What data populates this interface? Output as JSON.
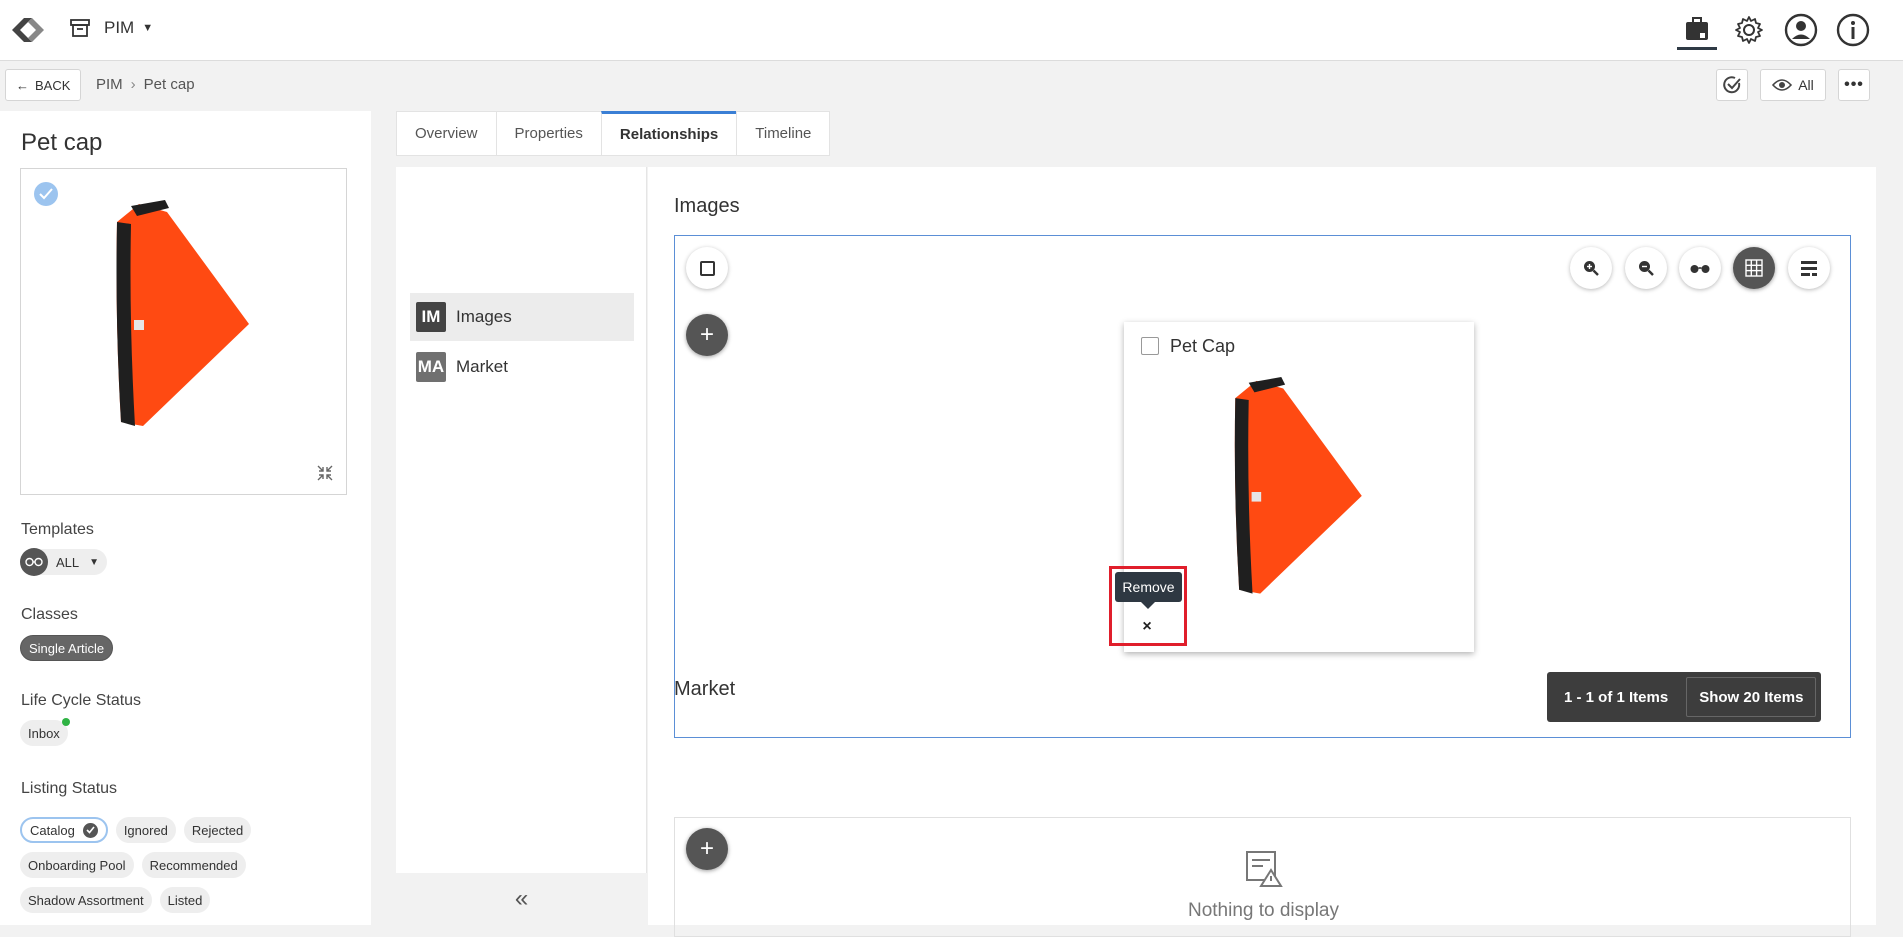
{
  "topbar": {
    "module_label": "PIM"
  },
  "subbar": {
    "back_label": "BACK",
    "breadcrumb": [
      "PIM",
      "Pet cap"
    ],
    "view_label": "All"
  },
  "left": {
    "title": "Pet cap",
    "templates_label": "Templates",
    "templates_value": "ALL",
    "classes_label": "Classes",
    "classes": [
      "Single Article"
    ],
    "lifecycle_label": "Life Cycle Status",
    "lifecycle_value": "Inbox",
    "listing_label": "Listing Status",
    "listing": [
      "Catalog",
      "Ignored",
      "Rejected",
      "Onboarding Pool",
      "Recommended",
      "Shadow Assortment",
      "Listed"
    ]
  },
  "tabs": [
    "Overview",
    "Properties",
    "Relationships",
    "Timeline"
  ],
  "relationships": [
    {
      "badge": "IM",
      "label": "Images"
    },
    {
      "badge": "MA",
      "label": "Market"
    }
  ],
  "images_section": {
    "title": "Images",
    "card_title": "Pet Cap",
    "tooltip": "Remove",
    "remove_glyph": "×",
    "count": "1 - 1 of 1 Items",
    "show_items": "Show 20 Items"
  },
  "market_section": {
    "title": "Market",
    "empty": "Nothing to display"
  },
  "colors": {
    "accent": "#3a7fd5",
    "highlight": "#e01e2b",
    "product": "#ff4a12"
  }
}
